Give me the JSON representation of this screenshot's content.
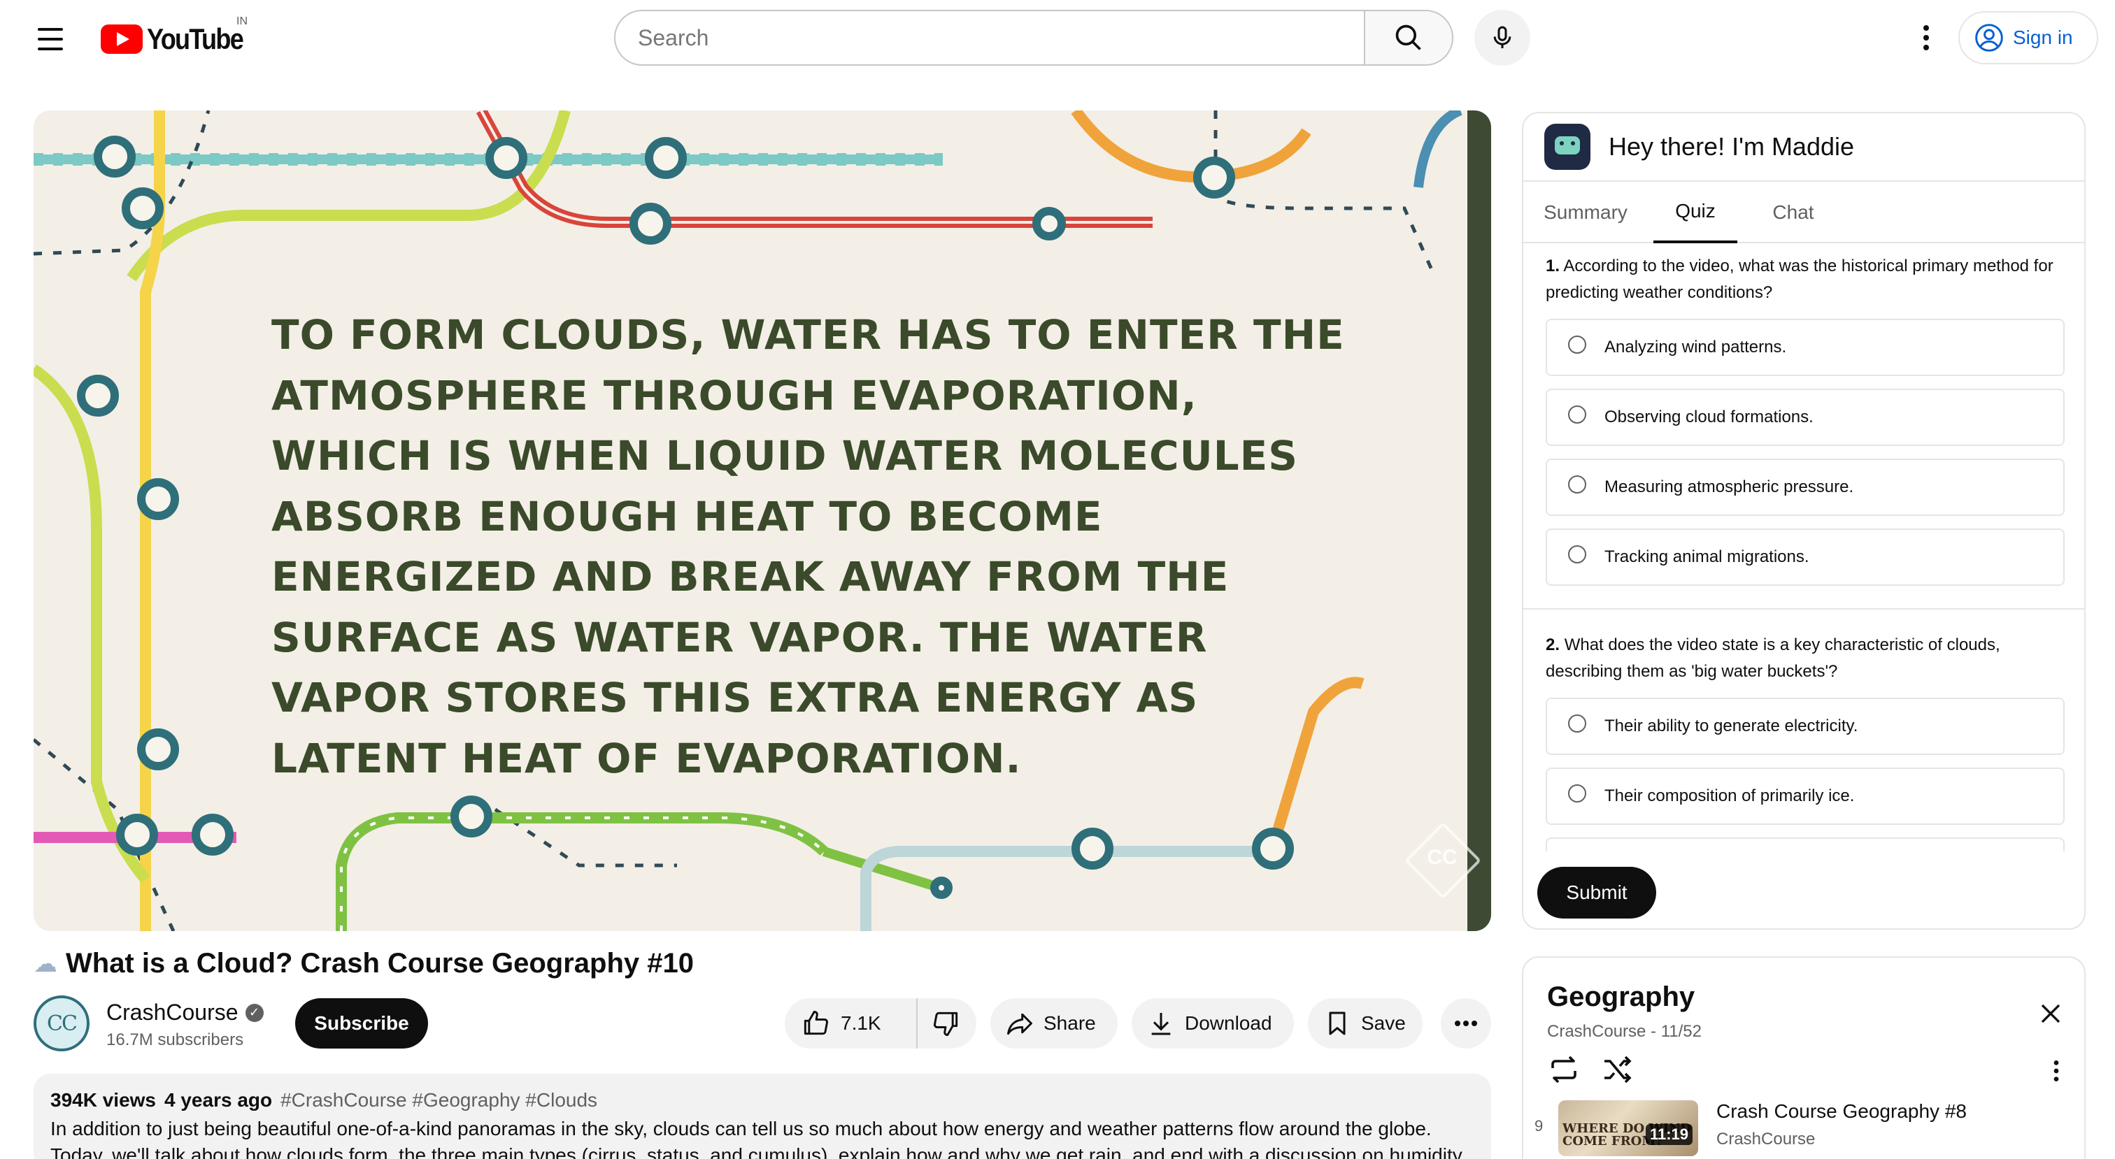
{
  "masthead": {
    "logo_text": "YouTube",
    "region": "IN",
    "search_placeholder": "Search",
    "signin_label": "Sign in"
  },
  "player": {
    "caption": "TO FORM CLOUDS, WATER HAS TO ENTER THE ATMOSPHERE THROUGH EVAPORATION, WHICH IS WHEN LIQUID WATER MOLECULES ABSORB ENOUGH HEAT TO BECOME ENERGIZED AND BREAK AWAY FROM THE SURFACE AS WATER VAPOR. THE WATER VAPOR STORES THIS EXTRA ENERGY AS LATENT HEAT OF EVAPORATION.",
    "watermark": "CC"
  },
  "video": {
    "title": "What is a Cloud? Crash Course Geography #10",
    "channel": "CrashCourse",
    "channel_avatar_text": "CC",
    "subscribers": "16.7M subscribers",
    "subscribe_label": "Subscribe",
    "likes": "7.1K",
    "share_label": "Share",
    "download_label": "Download",
    "save_label": "Save"
  },
  "description": {
    "views": "394K views",
    "ago": "4 years ago",
    "tags": "#CrashCourse #Geography #Clouds",
    "text": "In addition to just being beautiful one-of-a-kind panoramas in the sky, clouds can tell us so much about how energy and weather patterns flow around the globe. Today, we'll talk about how clouds form, the three main types (cirrus, status, and cumulus), explain how and why we get rain, and end with a discussion on humidity."
  },
  "assistant": {
    "title": "Hey there! I'm Maddie",
    "tabs": [
      "Summary",
      "Quiz",
      "Chat"
    ],
    "active_tab": "Quiz",
    "questions": [
      {
        "number": "1.",
        "text": "According to the video, what was the historical primary method for predicting weather conditions?",
        "options": [
          "Analyzing wind patterns.",
          "Observing cloud formations.",
          "Measuring atmospheric pressure.",
          "Tracking animal migrations."
        ]
      },
      {
        "number": "2.",
        "text": "What does the video state is a key characteristic of clouds, describing them as 'big water buckets'?",
        "options": [
          "Their ability to generate electricity.",
          "Their composition of primarily ice."
        ]
      }
    ],
    "submit_label": "Submit"
  },
  "playlist": {
    "title": "Geography",
    "channel": "CrashCourse",
    "position": "11/52",
    "item": {
      "index": "9",
      "thumb_text": "WHERE DO WIND COME FROM?",
      "duration": "11:19",
      "title": "Crash Course Geography #8",
      "channel": "CrashCourse"
    }
  },
  "colors": {
    "youtube_red": "#ff0000",
    "link_blue": "#065fd4",
    "chip_bg": "#f2f2f2",
    "teal_station": "#2e6f7a"
  }
}
